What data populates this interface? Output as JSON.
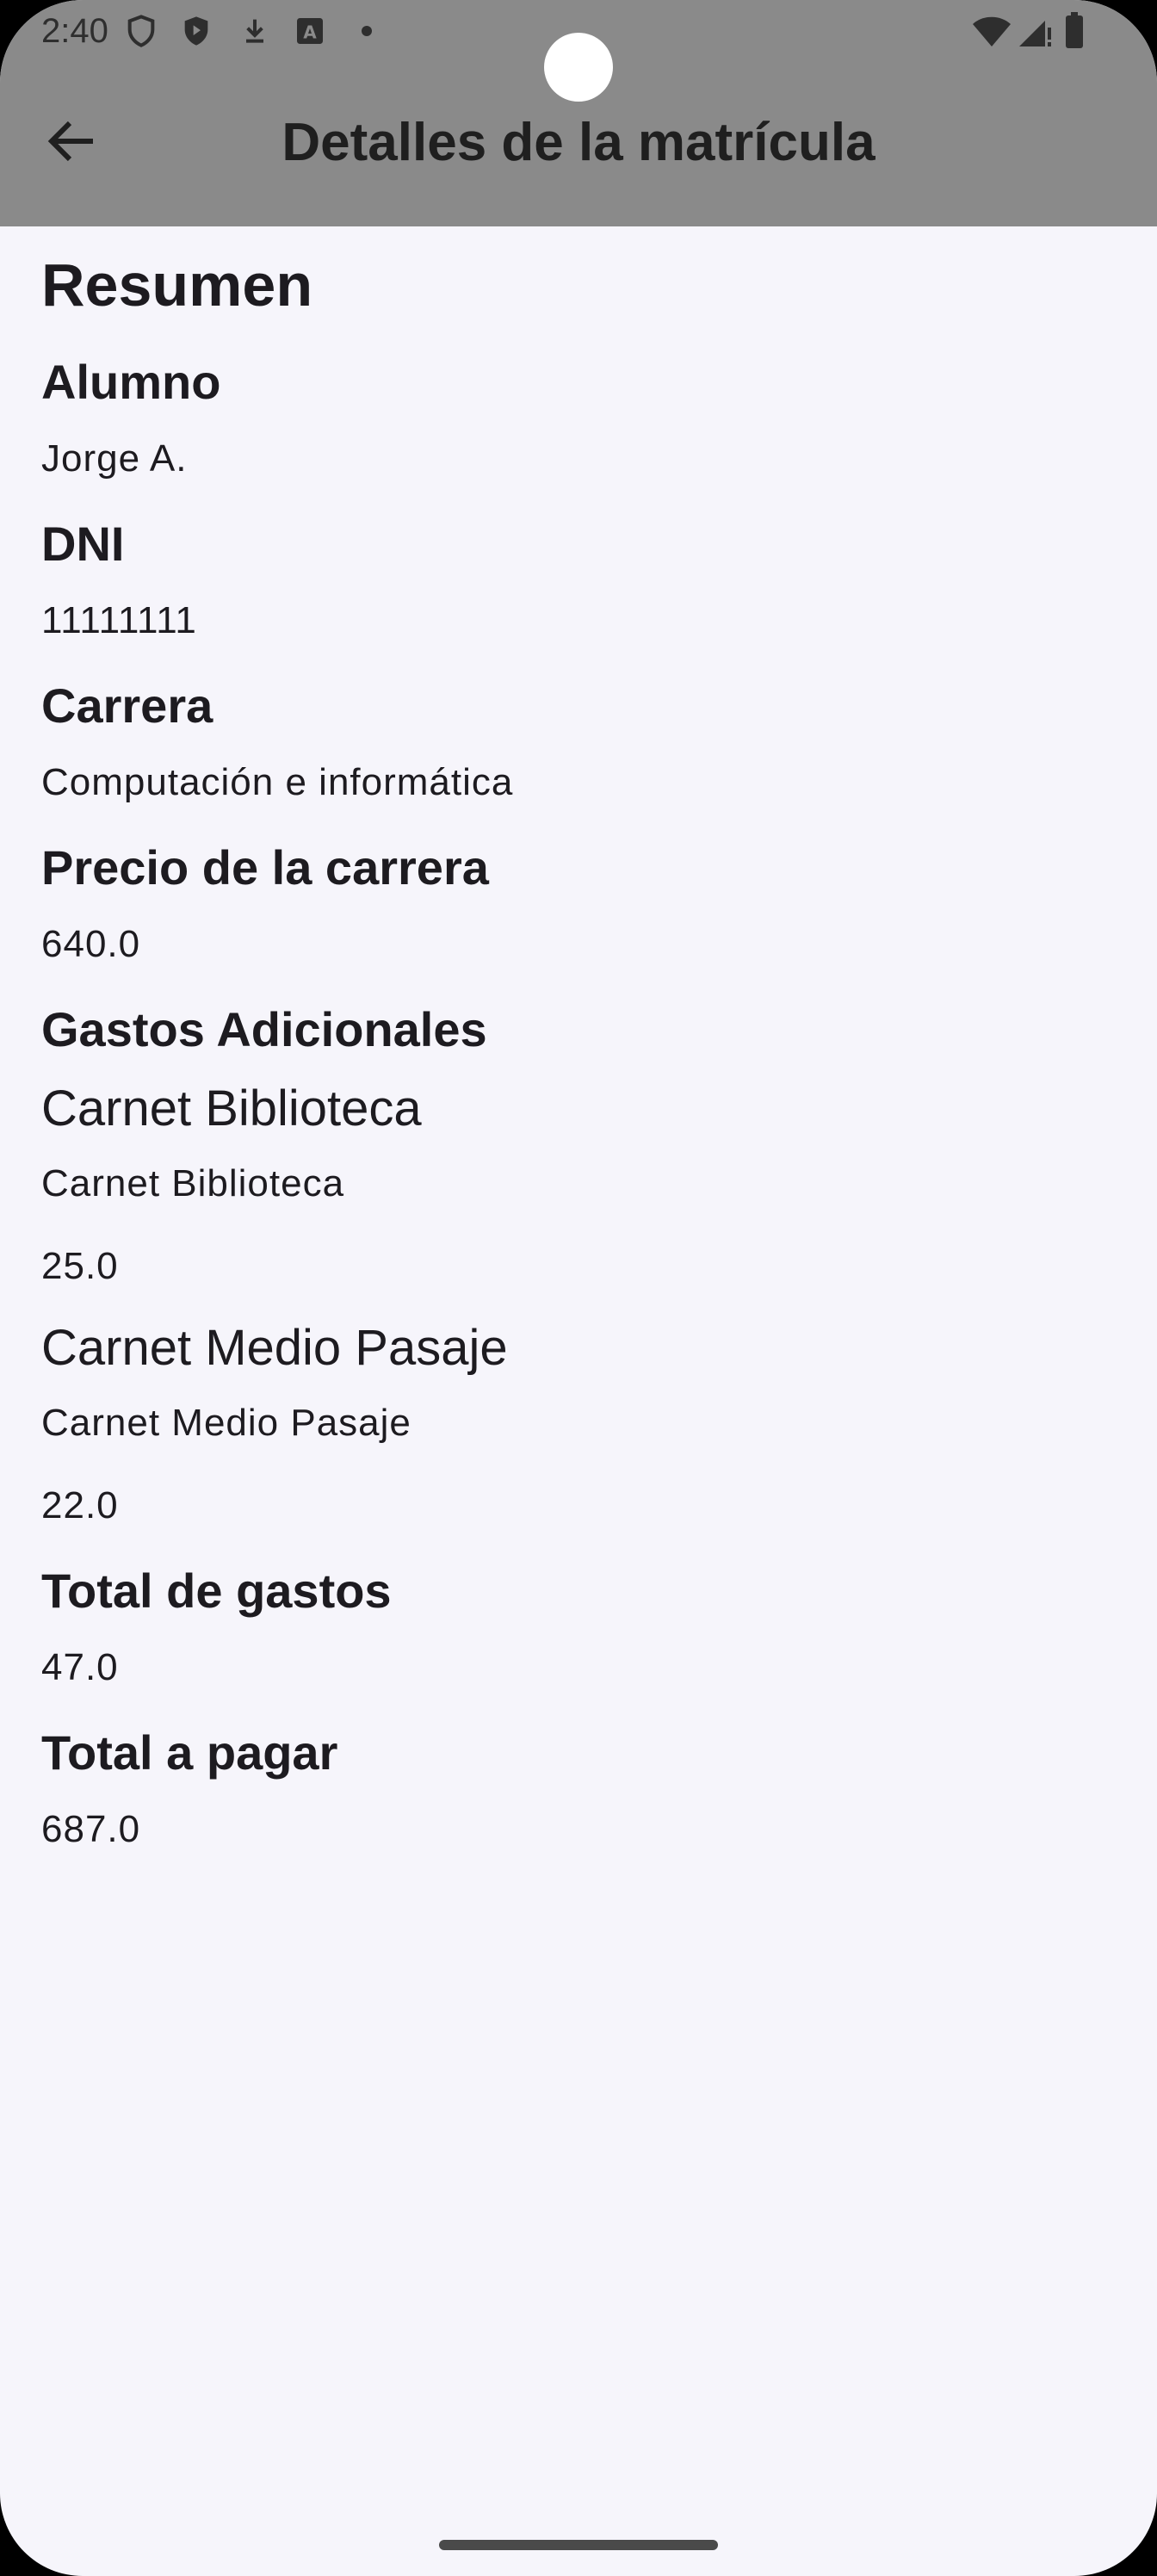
{
  "status_bar": {
    "time": "2:40",
    "icons": [
      "shield-icon",
      "play-protect-icon",
      "download-icon",
      "font-a-icon",
      "dot-icon",
      "wifi-icon",
      "signal-icon",
      "battery-icon"
    ]
  },
  "app_bar": {
    "back_icon": "arrow-left-icon",
    "title": "Detalles de la matrícula"
  },
  "summary": {
    "heading": "Resumen",
    "student_label": "Alumno",
    "student_value": "Jorge A.",
    "dni_label": "DNI",
    "dni_value": "11111111",
    "career_label": "Carrera",
    "career_value": "Computación e informática",
    "price_label": "Precio de la carrera",
    "price_value": "640.0",
    "extras_label": "Gastos Adicionales",
    "extras": [
      {
        "title": "Carnet Biblioteca",
        "description": "Carnet Biblioteca",
        "price": "25.0"
      },
      {
        "title": "Carnet Medio Pasaje",
        "description": "Carnet Medio Pasaje",
        "price": "22.0"
      }
    ],
    "total_expenses_label": "Total de gastos",
    "total_expenses_value": "47.0",
    "total_pay_label": "Total a pagar",
    "total_pay_value": "687.0"
  },
  "colors": {
    "app_bar": "#8a8a8a",
    "background": "#f6f5fb",
    "text": "#1d1b20"
  }
}
